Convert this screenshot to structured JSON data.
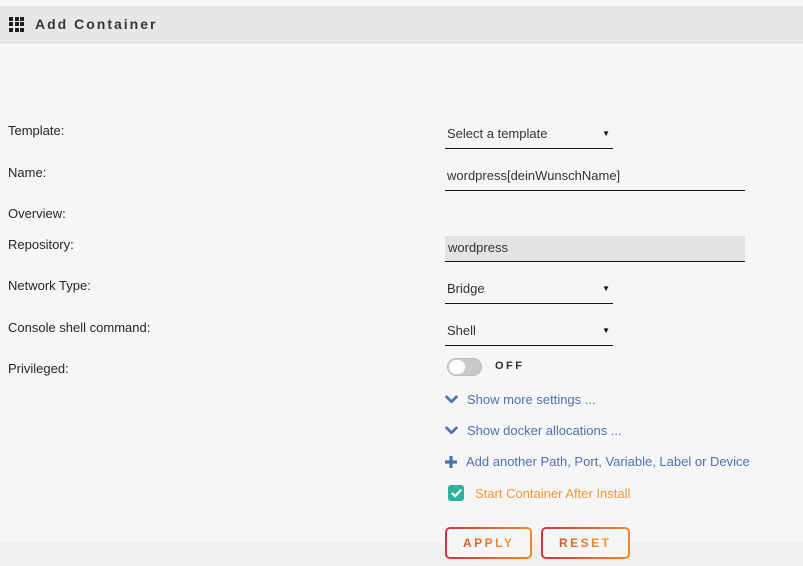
{
  "header": {
    "title": "Add Container",
    "icon": "grid-icon"
  },
  "form": {
    "template": {
      "label": "Template:",
      "value": "Select a template"
    },
    "name": {
      "label": "Name:",
      "value": "wordpress[deinWunschName]"
    },
    "overview": {
      "label": "Overview:"
    },
    "repository": {
      "label": "Repository:",
      "value": "wordpress"
    },
    "network": {
      "label": "Network Type:",
      "value": "Bridge"
    },
    "console": {
      "label": "Console shell command:",
      "value": "Shell"
    },
    "privileged": {
      "label": "Privileged:",
      "state": "OFF",
      "enabled": false
    }
  },
  "links": {
    "more_settings": "Show more settings ...",
    "docker_allocations": "Show docker allocations ...",
    "add_another": "Add another Path, Port, Variable, Label or Device"
  },
  "checkbox": {
    "label": "Start Container After Install",
    "checked": true
  },
  "buttons": {
    "apply": "APPLY",
    "reset": "RESET"
  },
  "colors": {
    "link_blue": "#4d72b0",
    "accent_orange": "#f0953b",
    "checkbox_green": "#2ab39a",
    "button_gradient_start": "#c8373f",
    "button_gradient_end": "#ee8a2d",
    "header_bg": "#e7e7e7",
    "field_shade": "#e3e3e3"
  }
}
